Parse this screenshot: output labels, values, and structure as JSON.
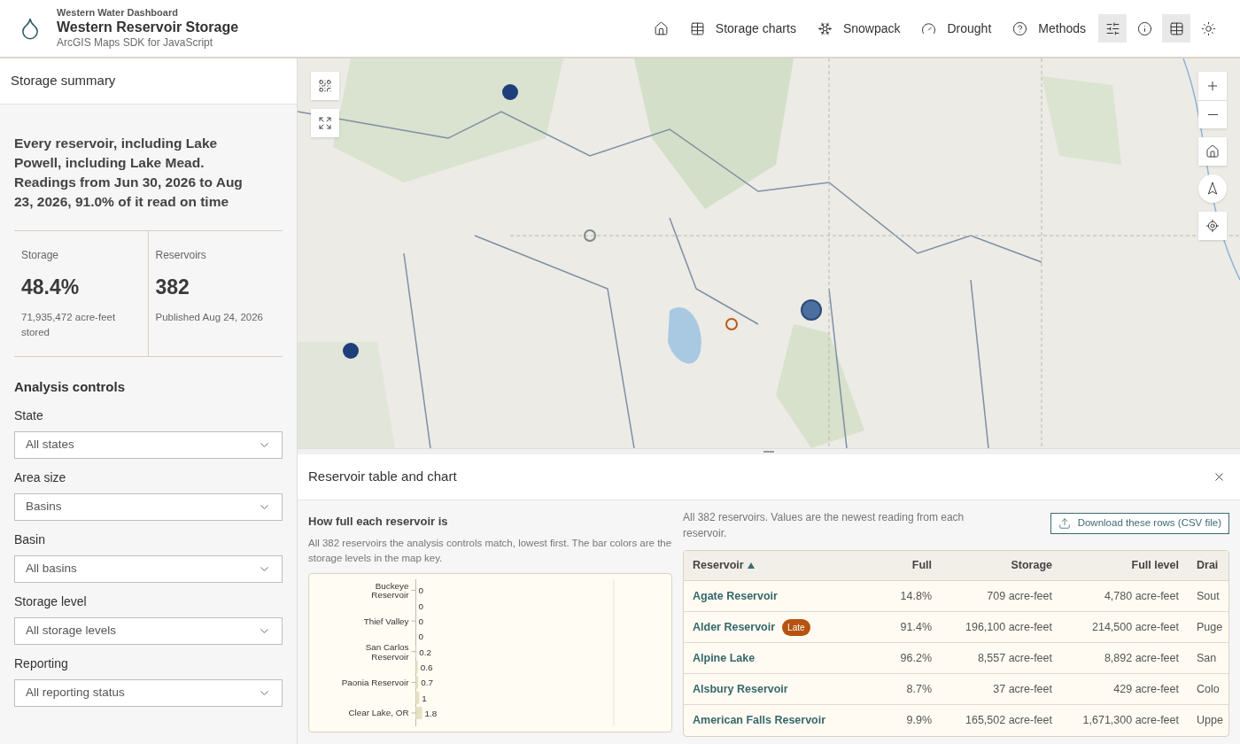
{
  "header": {
    "eyebrow": "Western Water Dashboard",
    "title": "Western Reservoir Storage",
    "subtitle": "ArcGIS Maps SDK for JavaScript"
  },
  "nav": [
    {
      "kind": "home"
    },
    {
      "kind": "table",
      "label": "Storage charts"
    },
    {
      "kind": "snow",
      "label": "Snowpack"
    },
    {
      "kind": "gauge",
      "label": "Drought"
    },
    {
      "kind": "help",
      "label": "Methods"
    }
  ],
  "tools": [
    {
      "kind": "filters",
      "selected": true
    },
    {
      "kind": "info",
      "selected": false
    },
    {
      "kind": "table",
      "selected": true
    },
    {
      "kind": "sun",
      "selected": false
    }
  ],
  "sidebar": {
    "title": "Storage summary",
    "summary": "Every reservoir, including Lake Powell, including Lake Mead. Readings from Jun 30, 2026 to Aug 23, 2026, 91.0% of it read on time",
    "stats": [
      {
        "label": "Storage",
        "value": "48.4%",
        "note": "71,935,472 acre-feet stored"
      },
      {
        "label": "Reservoirs",
        "value": "382",
        "note": "Published Aug 24, 2026"
      }
    ],
    "controls_title": "Analysis controls",
    "controls": [
      {
        "label": "State",
        "value": "All states"
      },
      {
        "label": "Area size",
        "value": "Basins"
      },
      {
        "label": "Basin",
        "value": "All basins"
      },
      {
        "label": "Storage level",
        "value": "All storage levels"
      },
      {
        "label": "Reporting",
        "value": "All reporting status"
      }
    ]
  },
  "map": {
    "kind": "picture",
    "controls_left": [
      {
        "kind": "grid"
      },
      {
        "kind": "expand"
      }
    ],
    "controls_right": [
      {
        "kind": "zoom-in"
      },
      {
        "kind": "zoom-out"
      },
      {
        "kind": "home"
      },
      {
        "kind": "compass"
      },
      {
        "kind": "locate"
      }
    ]
  },
  "panel": {
    "title": "Reservoir table and chart",
    "chart": {
      "heading": "How full each reservoir is",
      "description": "All 382 reservoirs the analysis controls match, lowest first. The bar colors are the storage levels in the map key.",
      "chart_data": {
        "type": "bar",
        "orientation": "horizontal",
        "categories": [
          "Buckeye Reservoir",
          null,
          "Thief Valley",
          null,
          "San Carlos Reservoir",
          null,
          "Paonia Reservoir",
          null,
          "Clear Lake, OR"
        ],
        "series": [
          {
            "color": "#e6e0c4",
            "values": [
              0,
              0,
              0,
              0,
              0.2,
              0.6,
              0.7,
              1,
              1.8
            ]
          }
        ],
        "data_labels": true
      }
    },
    "table": {
      "note": "All 382 reservoirs. Values are the newest reading from each reservoir.",
      "download": "Download these rows (CSV file)",
      "columns": [
        {
          "label": "Reservoir",
          "sorted": true
        },
        {
          "label": "Full",
          "sorted": false
        },
        {
          "label": "Storage",
          "sorted": false
        },
        {
          "label": "Full level",
          "sorted": false
        },
        {
          "label": "Drai",
          "sorted": false
        }
      ],
      "rows": [
        {
          "cells": [
            "Agate Reservoir",
            "14.8%",
            "709 acre-feet",
            "4,780 acre-feet",
            "Sout"
          ]
        },
        {
          "cells": [
            "Alder Reservoir",
            "91.4%",
            "196,100 acre-feet",
            "214,500 acre-feet",
            "Puge"
          ],
          "badge": "Late"
        },
        {
          "cells": [
            "Alpine Lake",
            "96.2%",
            "8,557 acre-feet",
            "8,892 acre-feet",
            "San"
          ]
        },
        {
          "cells": [
            "Alsbury Reservoir",
            "8.7%",
            "37 acre-feet",
            "429 acre-feet",
            "Colo"
          ]
        },
        {
          "cells": [
            "American Falls Reservoir",
            "9.9%",
            "165,502 acre-feet",
            "1,671,300 acre-feet",
            "Uppe"
          ]
        }
      ]
    }
  }
}
